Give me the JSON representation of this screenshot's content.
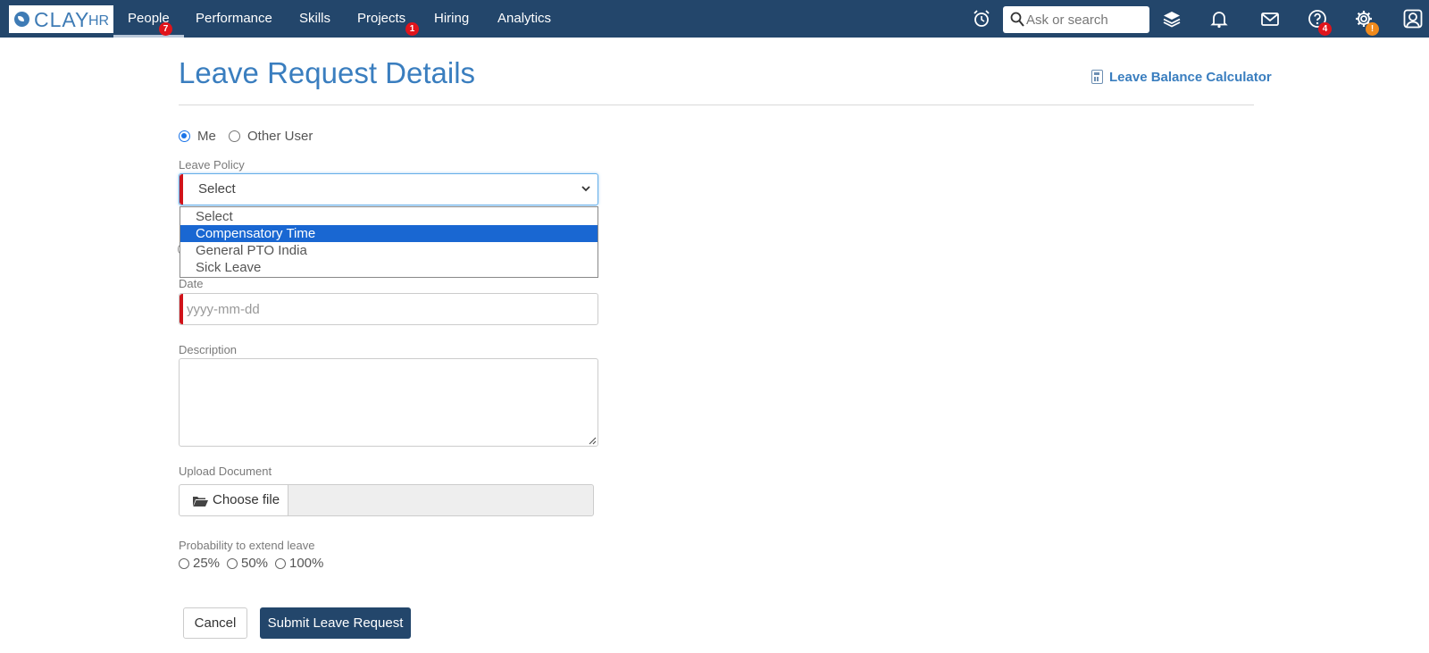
{
  "nav": {
    "logo_text": "CLAY",
    "logo_suffix": "HR",
    "items": [
      {
        "label": "People",
        "badge": "7",
        "active": true
      },
      {
        "label": "Performance"
      },
      {
        "label": "Skills"
      },
      {
        "label": "Projects",
        "badge": "1"
      },
      {
        "label": "Hiring"
      },
      {
        "label": "Analytics"
      }
    ],
    "search_placeholder": "Ask or search",
    "help_badge": "4",
    "settings_badge": "!",
    "icons": [
      "alarm-clock-icon",
      "search-icon",
      "layers-icon",
      "bell-icon",
      "mail-icon",
      "help-icon",
      "gear-icon",
      "user-icon"
    ],
    "colors": {
      "nav_bg": "#23466b",
      "badge_red": "#e0141b",
      "badge_orange": "#f08a1c"
    }
  },
  "page": {
    "title": "Leave Request Details",
    "calculator_link": "Leave Balance Calculator",
    "accent_color": "#3a7ebf"
  },
  "form": {
    "user_options": [
      {
        "label": "Me",
        "checked": true
      },
      {
        "label": "Other User",
        "checked": false
      }
    ],
    "leave_policy": {
      "label": "Leave Policy",
      "selected": "Select",
      "options": [
        "Select",
        "Compensatory Time",
        "General PTO India",
        "Sick Leave"
      ],
      "highlighted": "Compensatory Time"
    },
    "date": {
      "label": "Date",
      "placeholder": "yyyy-mm-dd",
      "value": ""
    },
    "description": {
      "label": "Description",
      "value": ""
    },
    "upload": {
      "label": "Upload Document",
      "button": "Choose file",
      "filename": ""
    },
    "probability": {
      "label": "Probability to extend leave",
      "options": [
        "25%",
        "50%",
        "100%"
      ]
    },
    "cancel_label": "Cancel",
    "submit_label": "Submit Leave Request"
  }
}
